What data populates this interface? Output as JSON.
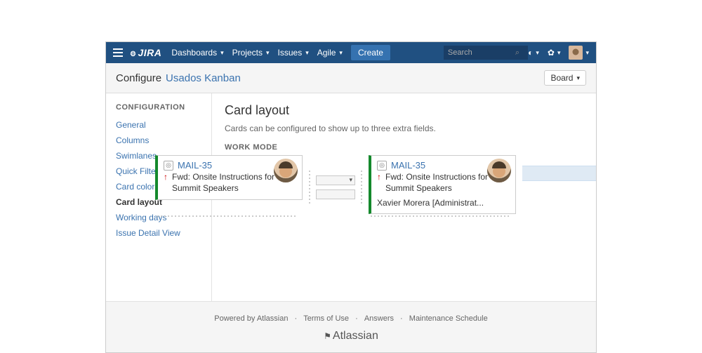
{
  "navbar": {
    "logo": "JIRA",
    "items": [
      "Dashboards",
      "Projects",
      "Issues",
      "Agile"
    ],
    "create": "Create",
    "search_placeholder": "Search"
  },
  "subheader": {
    "configure": "Configure",
    "board_name": "Usados Kanban",
    "board_btn": "Board"
  },
  "sidebar": {
    "heading": "CONFIGURATION",
    "items": [
      "General",
      "Columns",
      "Swimlanes",
      "Quick Filters",
      "Card colors",
      "Card layout",
      "Working days",
      "Issue Detail View"
    ],
    "active_index": 5
  },
  "main": {
    "title": "Card layout",
    "description": "Cards can be configured to show up to three extra fields.",
    "section": "WORK MODE"
  },
  "cards": [
    {
      "key": "MAIL-35",
      "priority_icon": "↑",
      "summary": "Fwd: Onsite Instructions for Summit Speakers"
    },
    {
      "key": "MAIL-35",
      "priority_icon": "↑",
      "summary": "Fwd: Onsite Instructions for Summit Speakers",
      "assignee": "Xavier Morera [Administrat..."
    }
  ],
  "footer": {
    "links": [
      "Powered by Atlassian",
      "Terms of Use",
      "Answers",
      "Maintenance Schedule"
    ],
    "brand": "Atlassian"
  }
}
